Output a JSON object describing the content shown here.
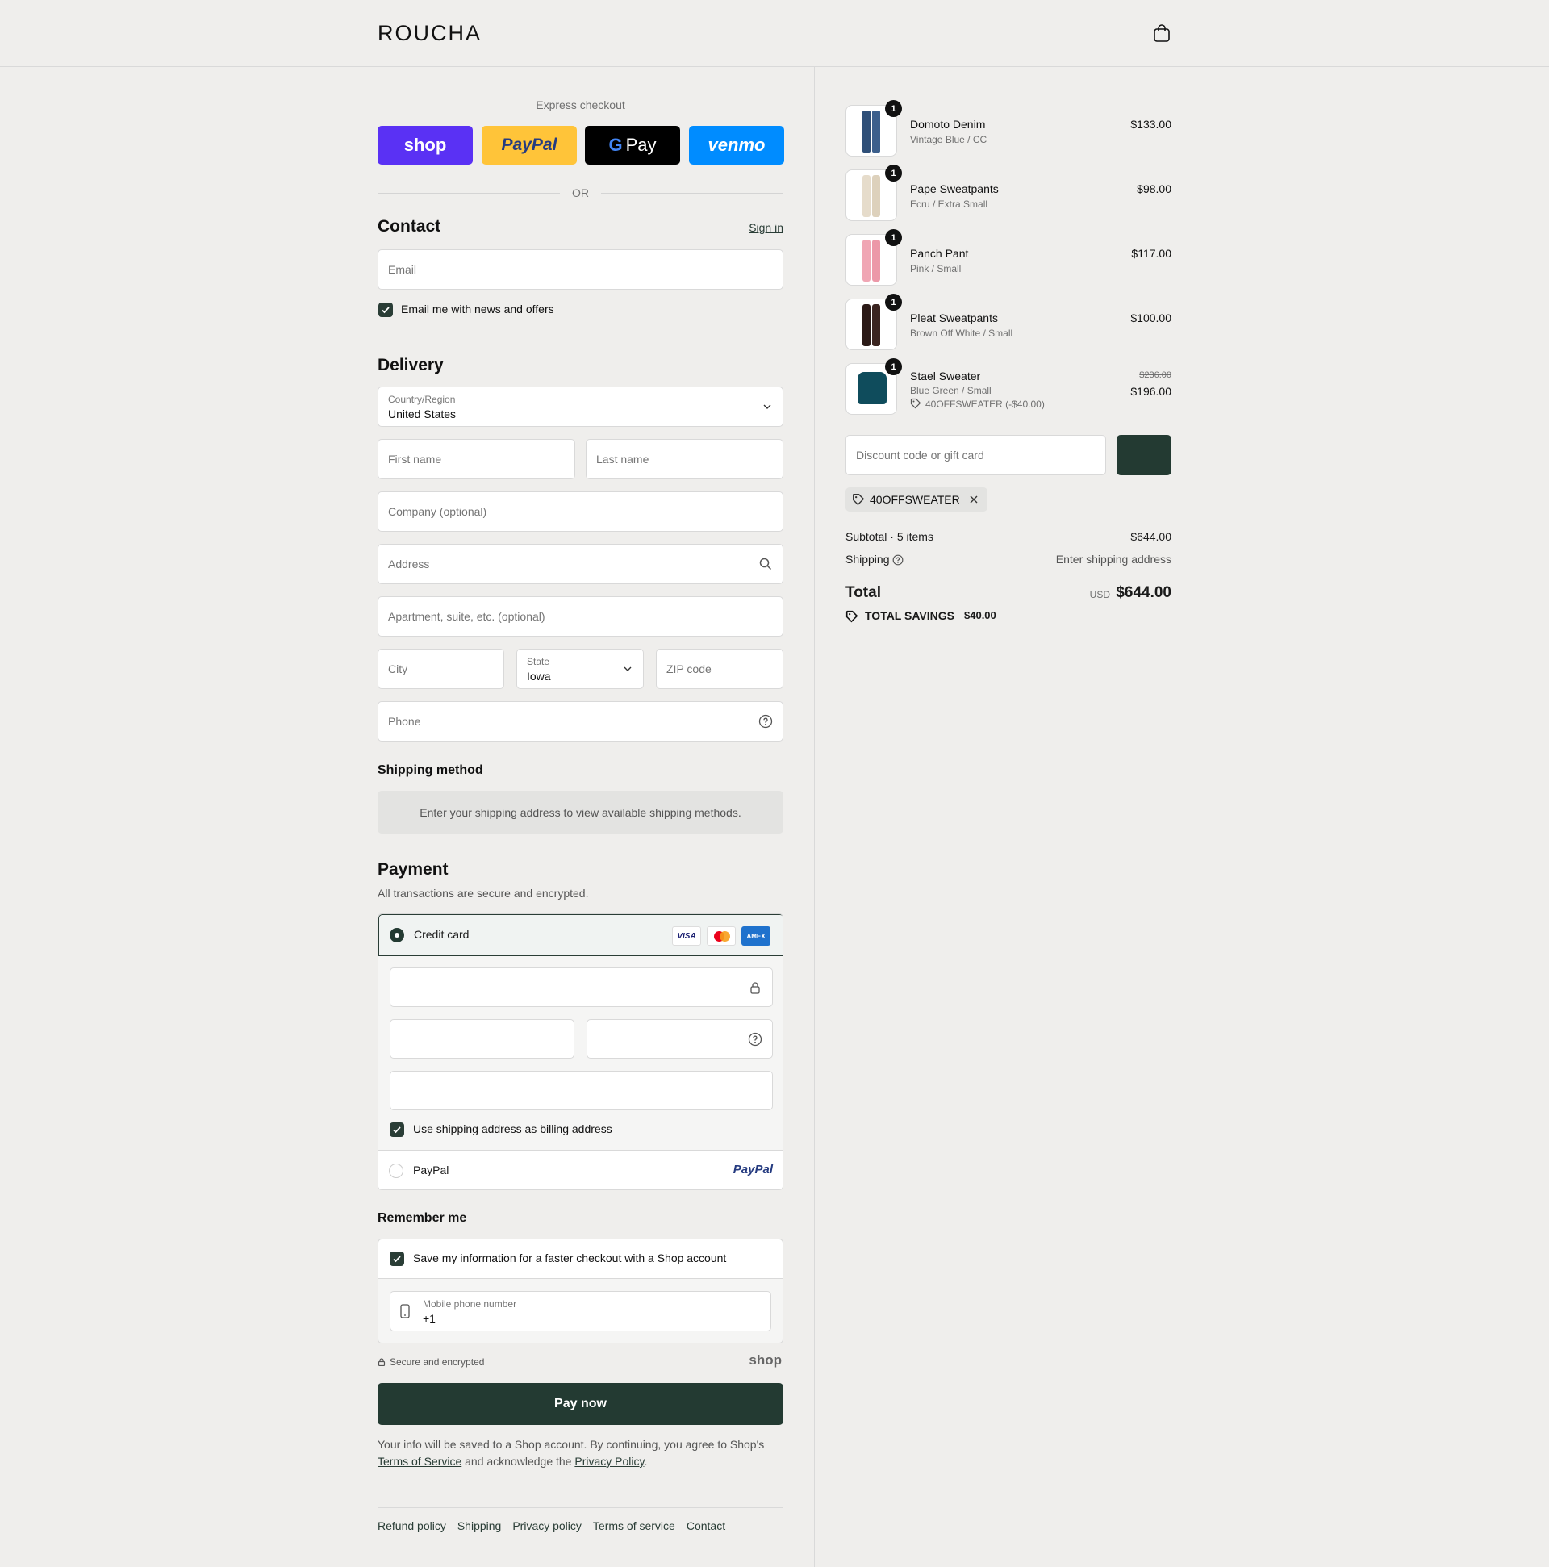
{
  "header": {
    "brand": "ROUCHA",
    "cart_icon": "shopping-bag-icon"
  },
  "express": {
    "title": "Express checkout",
    "buttons": [
      {
        "label": "shop",
        "color": "#5a31f4",
        "text_color": "#ffffff"
      },
      {
        "label": "PayPal",
        "color": "#ffc439",
        "text_color": "#253b80"
      },
      {
        "label": "Pay",
        "color": "#000000",
        "text_color": "#ffffff"
      },
      {
        "label": "venmo",
        "color": "#008cff",
        "text_color": "#ffffff"
      }
    ],
    "or": "OR"
  },
  "contact": {
    "title": "Contact",
    "sign_in": "Sign in",
    "email_placeholder": "Email",
    "newsletter": "Email me with news and offers",
    "newsletter_checked": true
  },
  "delivery": {
    "title": "Delivery",
    "country_label": "Country/Region",
    "country_value": "United States",
    "first_name": "First name",
    "last_name": "Last name",
    "company": "Company (optional)",
    "address": "Address",
    "apartment": "Apartment, suite, etc. (optional)",
    "city": "City",
    "state_label": "State",
    "state_value": "Iowa",
    "zip": "ZIP code",
    "phone": "Phone"
  },
  "shipping_method": {
    "title": "Shipping method",
    "message": "Enter your shipping address to view available shipping methods."
  },
  "payment": {
    "title": "Payment",
    "subtitle": "All transactions are secure and encrypted.",
    "credit_card": "Credit card",
    "card_brands": [
      "VISA",
      "MC",
      "AMEX"
    ],
    "billing_same": "Use shipping address as billing address",
    "paypal": "PayPal",
    "paypal_logo": "PayPal"
  },
  "remember": {
    "title": "Remember me",
    "save": "Save my information for a faster checkout with a Shop account",
    "mobile_label": "Mobile phone number",
    "mobile_value": "+1",
    "secure": "Secure and encrypted",
    "shop_logo": "shop"
  },
  "pay_now": "Pay now",
  "fine_print": {
    "part1": "Your info will be saved to a Shop account. By continuing, you agree to Shop's ",
    "terms": "Terms of Service",
    "part2": " and acknowledge the ",
    "privacy": "Privacy Policy",
    "part3": "."
  },
  "footer": [
    "Refund policy",
    "Shipping",
    "Privacy policy",
    "Terms of service",
    "Contact"
  ],
  "cart": {
    "items": [
      {
        "name": "Domoto Denim",
        "variant": "Vintage Blue / CC",
        "price": "$133.00",
        "qty": "1",
        "color": "#2f4f78"
      },
      {
        "name": "Pape Sweatpants",
        "variant": "Ecru / Extra Small",
        "price": "$98.00",
        "qty": "1",
        "color": "#e6dccb"
      },
      {
        "name": "Panch Pant",
        "variant": "Pink / Small",
        "price": "$117.00",
        "qty": "1",
        "color": "#f0a6b4"
      },
      {
        "name": "Pleat Sweatpants",
        "variant": "Brown Off White / Small",
        "price": "$100.00",
        "qty": "1",
        "color": "#2b1a17"
      },
      {
        "name": "Stael Sweater",
        "variant": "Blue Green / Small",
        "price": "$196.00",
        "original_price": "$236.00",
        "discount": "40OFFSWEATER (-$40.00)",
        "qty": "1",
        "color": "#0f4c5c"
      }
    ],
    "discount_placeholder": "Discount code or gift card",
    "applied_code": "40OFFSWEATER",
    "subtotal_label": "Subtotal · 5 items",
    "subtotal": "$644.00",
    "shipping_label": "Shipping",
    "shipping_value": "Enter shipping address",
    "total_label": "Total",
    "currency": "USD",
    "total": "$644.00",
    "savings_label": "TOTAL SAVINGS",
    "savings": "$40.00"
  },
  "colors": {
    "accent": "#233a32",
    "background": "#efeeec"
  }
}
